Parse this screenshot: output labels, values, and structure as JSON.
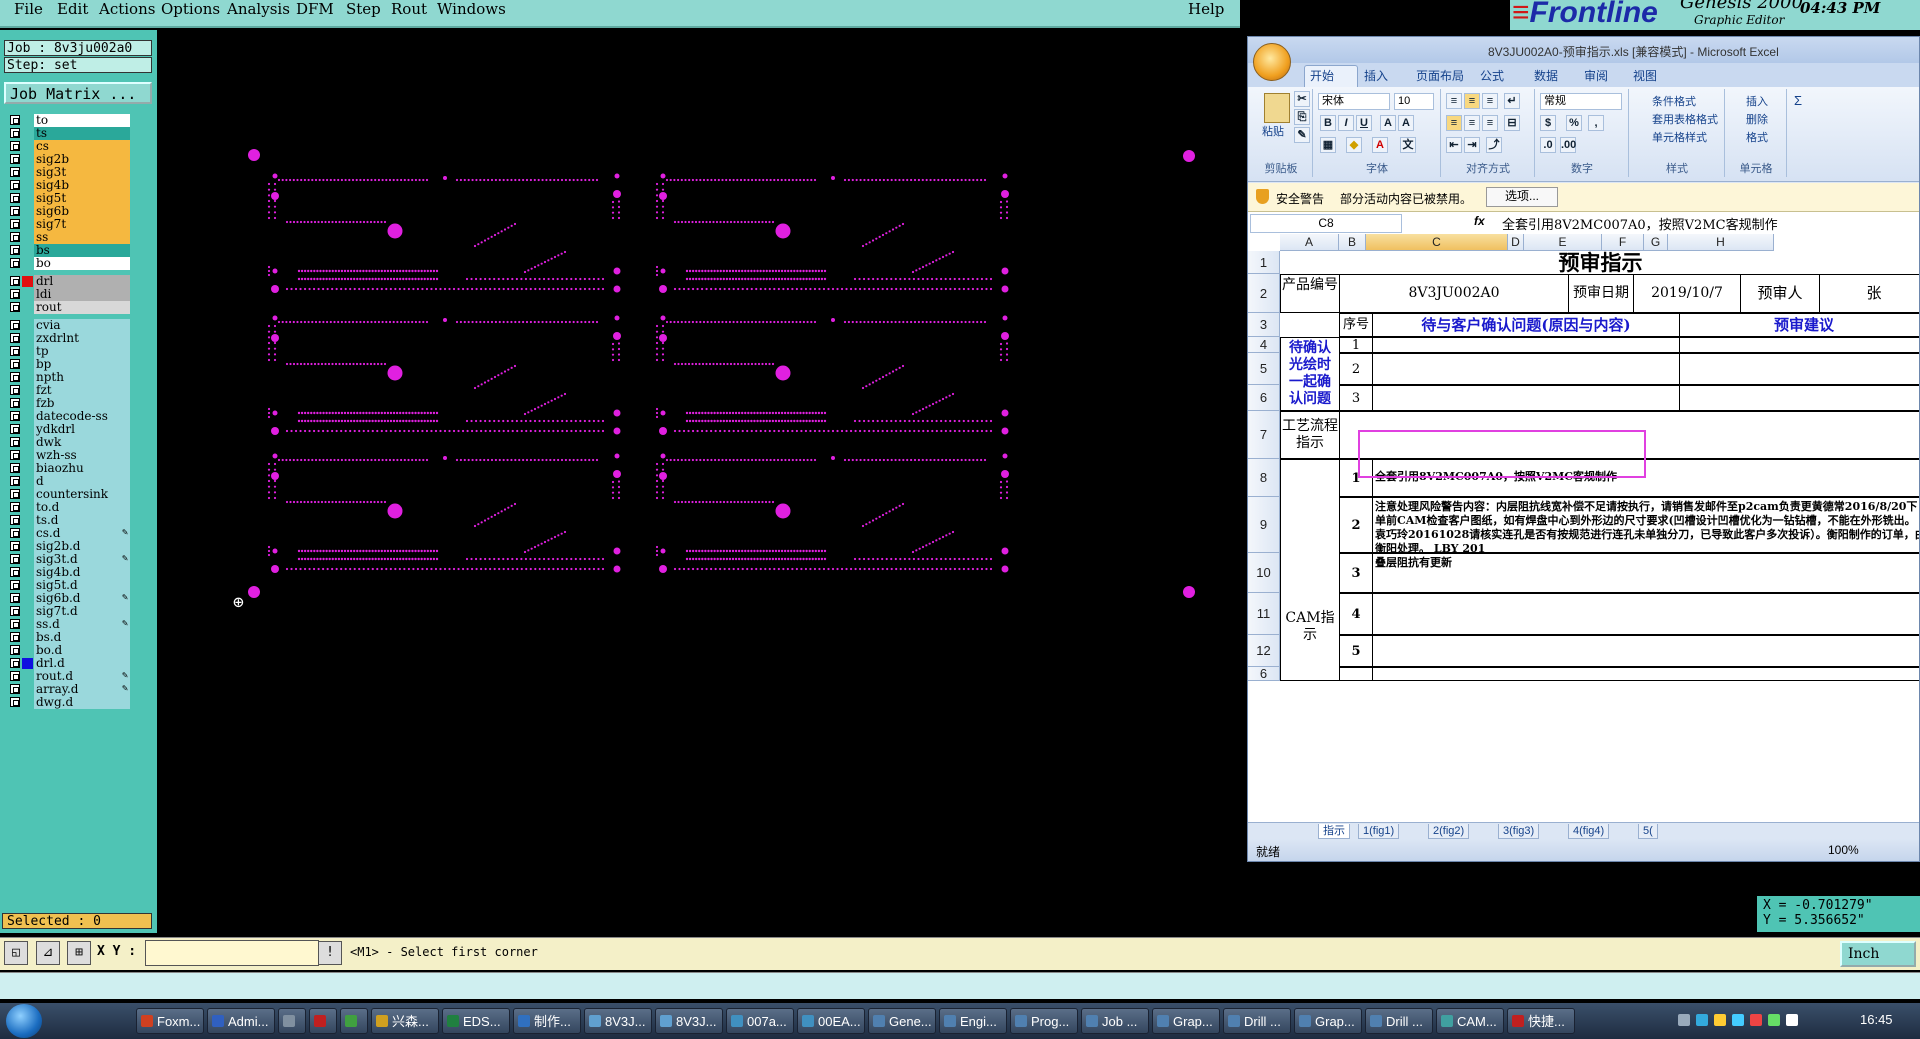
{
  "menu": {
    "items": [
      "File",
      "Edit",
      "Actions",
      "Options",
      "Analysis",
      "DFM",
      "Step",
      "Rout",
      "Windows"
    ],
    "help": "Help"
  },
  "brand": {
    "logo": "Frontline",
    "app_name": "Genesis 2000",
    "subtitle": "Graphic Editor",
    "time": "04:43 PM"
  },
  "job": {
    "job_line": "Job : 8v3ju002a0",
    "step_line": "Step: set",
    "job_matrix": "Job Matrix ..."
  },
  "layers": [
    {
      "name": "to",
      "color": "#ffffff"
    },
    {
      "name": "ts",
      "color": "#2aa89a"
    },
    {
      "name": "cs",
      "color": "#f5b840"
    },
    {
      "name": "sig2b",
      "color": "#f5b840"
    },
    {
      "name": "sig3t",
      "color": "#f5b840"
    },
    {
      "name": "sig4b",
      "color": "#f5b840"
    },
    {
      "name": "sig5t",
      "color": "#f5b840"
    },
    {
      "name": "sig6b",
      "color": "#f5b840"
    },
    {
      "name": "sig7t",
      "color": "#f5b840"
    },
    {
      "name": "ss",
      "color": "#f5b840"
    },
    {
      "name": "bs",
      "color": "#2aa89a"
    },
    {
      "name": "bo",
      "color": "#ffffff"
    },
    {
      "name": "drl",
      "color": "#b0b0b0",
      "swatch": "#e01010",
      "active": true
    },
    {
      "name": "ldi",
      "color": "#b0b0b0"
    },
    {
      "name": "rout",
      "color": "#d8d8d8"
    },
    {
      "name": "cvia",
      "color": "#9ad8dc"
    },
    {
      "name": "zxdrlnt",
      "color": "#9ad8dc"
    },
    {
      "name": "tp",
      "color": "#9ad8dc"
    },
    {
      "name": "bp",
      "color": "#9ad8dc"
    },
    {
      "name": "npth",
      "color": "#9ad8dc"
    },
    {
      "name": "fzt",
      "color": "#9ad8dc"
    },
    {
      "name": "fzb",
      "color": "#9ad8dc"
    },
    {
      "name": "datecode-ss",
      "color": "#9ad8dc"
    },
    {
      "name": "ydkdrl",
      "color": "#9ad8dc"
    },
    {
      "name": "dwk",
      "color": "#9ad8dc"
    },
    {
      "name": "wzh-ss",
      "color": "#9ad8dc"
    },
    {
      "name": "biaozhu",
      "color": "#9ad8dc"
    },
    {
      "name": "d",
      "color": "#9ad8dc"
    },
    {
      "name": "countersink",
      "color": "#9ad8dc"
    },
    {
      "name": "to.d",
      "color": "#9ad8dc"
    },
    {
      "name": "ts.d",
      "color": "#9ad8dc"
    },
    {
      "name": "cs.d",
      "color": "#9ad8dc",
      "pen": true
    },
    {
      "name": "sig2b.d",
      "color": "#9ad8dc"
    },
    {
      "name": "sig3t.d",
      "color": "#9ad8dc",
      "pen": true
    },
    {
      "name": "sig4b.d",
      "color": "#9ad8dc"
    },
    {
      "name": "sig5t.d",
      "color": "#9ad8dc"
    },
    {
      "name": "sig6b.d",
      "color": "#9ad8dc",
      "pen": true
    },
    {
      "name": "sig7t.d",
      "color": "#9ad8dc"
    },
    {
      "name": "ss.d",
      "color": "#9ad8dc",
      "pen": true
    },
    {
      "name": "bs.d",
      "color": "#9ad8dc"
    },
    {
      "name": "bo.d",
      "color": "#9ad8dc"
    },
    {
      "name": "drl.d",
      "color": "#9ad8dc",
      "swatch": "#1010e0"
    },
    {
      "name": "rout.d",
      "color": "#9ad8dc",
      "pen": true
    },
    {
      "name": "array.d",
      "color": "#9ad8dc",
      "pen": true
    },
    {
      "name": "dwg.d",
      "color": "#9ad8dc"
    }
  ],
  "selected": "Selected : 0",
  "command": {
    "xy_label": "X Y :",
    "xy_value": "",
    "prompt": "<M1> - Select first corner",
    "units": "Inch"
  },
  "coords": {
    "x": "X = -0.701279\"",
    "y": "Y = 5.356652\""
  },
  "excel": {
    "title": "8V3JU002A0-预审指示.xls  [兼容模式]  - Microsoft Excel",
    "tabs": [
      "开始",
      "插入",
      "页面布局",
      "公式",
      "数据",
      "审阅",
      "视图"
    ],
    "groups": [
      "剪贴板",
      "字体",
      "对齐方式",
      "数字",
      "样式",
      "单元格"
    ],
    "paste": "粘贴",
    "font_name": "宋体",
    "font_size": "10",
    "number_format": "常规",
    "style_items": [
      "条件格式",
      "套用表格格式",
      "单元格样式"
    ],
    "cell_items": [
      "插入",
      "删除",
      "格式"
    ],
    "security_label": "安全警告",
    "security_msg": "部分活动内容已被禁用。",
    "options_btn": "选项...",
    "name_box": "C8",
    "formula": "全套引用8V2MC007A0，按照V2MC客规制作",
    "columns": [
      "A",
      "B",
      "C",
      "D",
      "E",
      "F",
      "G",
      "H"
    ],
    "rows": [
      "1",
      "2",
      "3",
      "4",
      "5",
      "6",
      "7",
      "8",
      "9",
      "10",
      "11",
      "12",
      "6"
    ],
    "sheet": {
      "title": "预审指示",
      "product_label": "产品编号",
      "product_value": "8V3JU002A0",
      "date_label": "预审日期",
      "date_value": "2019/10/7",
      "reviewer_label": "预审人",
      "reviewer_value": "张",
      "seq_label": "序号",
      "question_header": "待与客户确认问题(原因与内容)",
      "suggest_header": "预审建议",
      "pending_label": "待确认光绘时一起确认问题",
      "process_label": "工艺流程指示",
      "cam_label": "CAM指示",
      "seq": [
        "1",
        "2",
        "3",
        "1",
        "2",
        "3",
        "4",
        "5"
      ],
      "cam_items": [
        "全套引用8V2MC007A0，按照V2MC客规制作",
        "注意处理风险警告内容：内层阻抗线宽补偿不足请按执行，请销售发邮件至p2cam负责更黄德常2016/8/20下单前CAM检查客户图纸，如有焊盘中心到外形边的尺寸要求(凹槽设计凹槽优化为一钻钻槽，不能在外形铣出。袁巧玲20161028请核实连孔是否有按规范进行连孔未单独分刀，已导致此客户多次投诉）。衡阳制作的订单，由衡阳处理。 LBY 201",
        "叠层阻抗有更新"
      ]
    },
    "sheet_tabs": [
      "指示",
      "1(fig1)",
      "2(fig2)",
      "3(fig3)",
      "4(fig4)",
      "5("
    ],
    "status": "就绪",
    "zoom": "100%"
  },
  "taskbar": {
    "items": [
      "Foxm...",
      "Admi...",
      "",
      "",
      "",
      "兴森...",
      "EDS...",
      "制作...",
      "8V3J...",
      "8V3J...",
      "007a...",
      "00EA...",
      "Gene...",
      "Engi...",
      "Prog...",
      "Job ...",
      "Grap...",
      "Drill ...",
      "Grap...",
      "Drill ...",
      "CAM...",
      "快捷..."
    ],
    "clock": "16:45"
  }
}
